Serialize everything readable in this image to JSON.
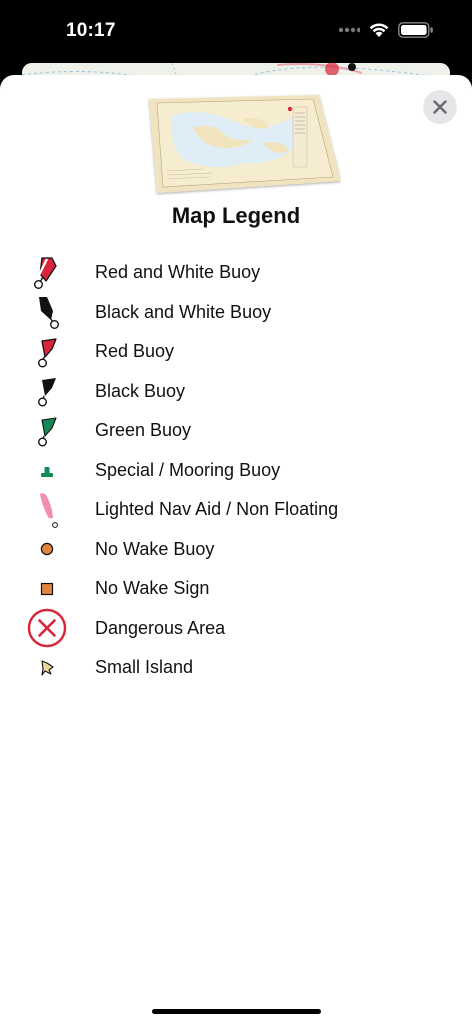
{
  "status": {
    "time": "10:17"
  },
  "sheet": {
    "title": "Map Legend",
    "close_icon": "close-icon"
  },
  "legend": [
    {
      "icon": "red-white-buoy-icon",
      "label": "Red and White Buoy"
    },
    {
      "icon": "black-white-buoy-icon",
      "label": "Black and White Buoy"
    },
    {
      "icon": "red-buoy-icon",
      "label": "Red Buoy"
    },
    {
      "icon": "black-buoy-icon",
      "label": "Black Buoy"
    },
    {
      "icon": "green-buoy-icon",
      "label": "Green Buoy"
    },
    {
      "icon": "mooring-buoy-icon",
      "label": "Special / Mooring Buoy"
    },
    {
      "icon": "lighted-nav-aid-icon",
      "label": "Lighted Nav Aid / Non Floating"
    },
    {
      "icon": "no-wake-buoy-icon",
      "label": "No Wake Buoy"
    },
    {
      "icon": "no-wake-sign-icon",
      "label": "No Wake Sign"
    },
    {
      "icon": "danger-area-icon",
      "label": "Dangerous Area"
    },
    {
      "icon": "small-island-icon",
      "label": "Small Island"
    }
  ],
  "colors": {
    "red": "#d9253b",
    "black": "#111111",
    "green": "#138a55",
    "pink": "#f08db0",
    "orange": "#e0843e",
    "island": "#ecd79a"
  }
}
